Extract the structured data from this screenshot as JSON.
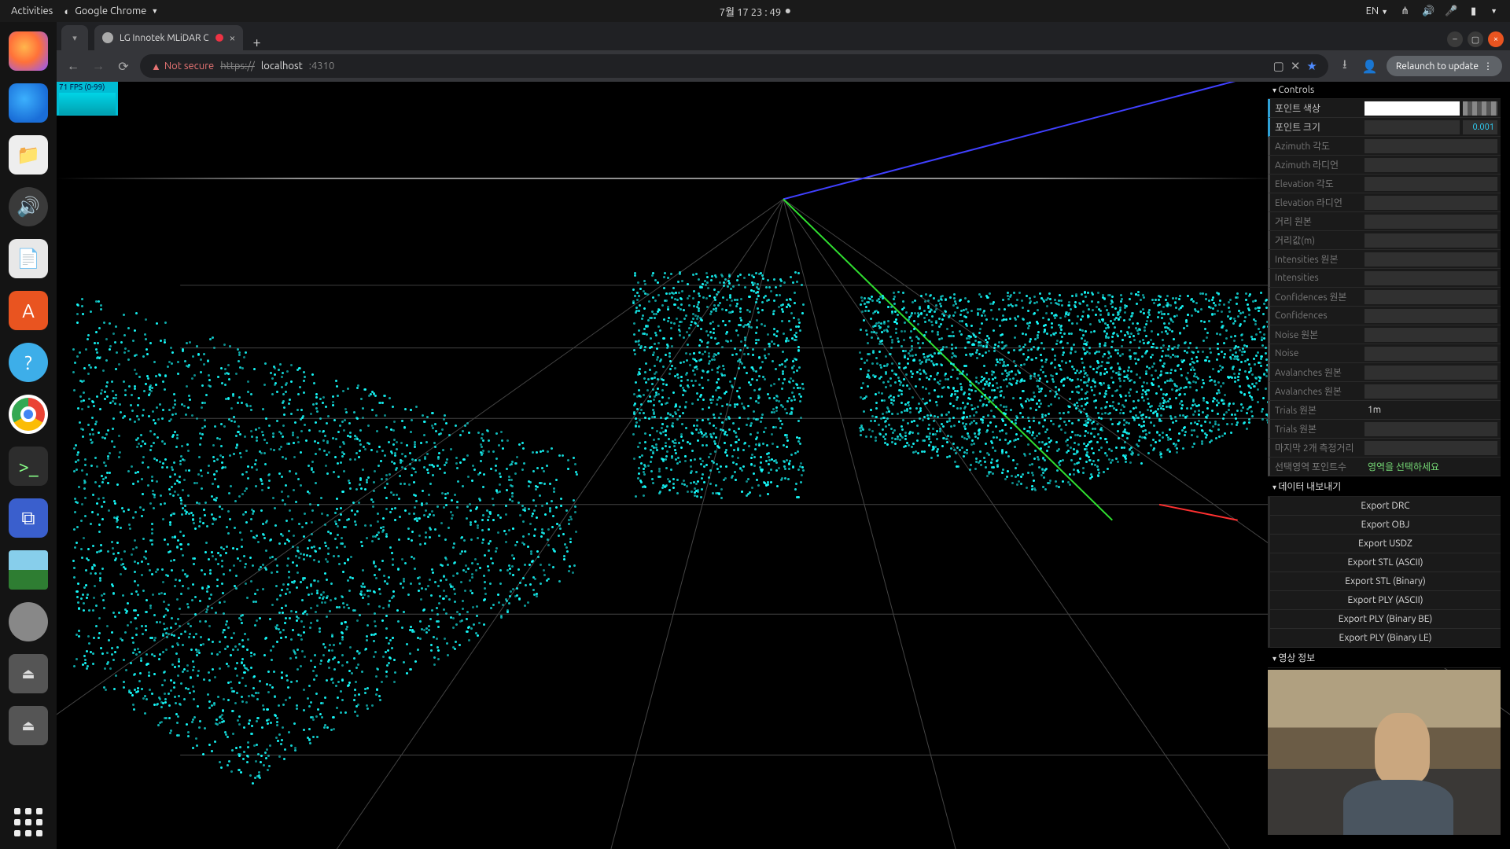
{
  "topbar": {
    "activities": "Activities",
    "app_menu": "Google Chrome",
    "clock": "7월 17  23 : 49",
    "lang": "EN"
  },
  "browser": {
    "tab_title": "LG Innotek MLiDAR C",
    "not_secure": "Not secure",
    "url_scheme": "https://",
    "url_host": "localhost",
    "url_port": ":4310",
    "relaunch": "Relaunch to update"
  },
  "fps": {
    "label": "71 FPS (0-99)"
  },
  "gui": {
    "sections": {
      "controls": "Controls",
      "export": "데이터 내보내기",
      "video": "영상 정보"
    },
    "point_color_label": "포인트 색상",
    "point_size": {
      "label": "포인트 크기",
      "value": "0.001"
    },
    "rows": [
      "Azimuth 각도",
      "Azimuth 라디언",
      "Elevation 각도",
      "Elevation 라디언",
      "거리 원본",
      "거리값(m)",
      "Intensities 원본",
      "Intensities",
      "Confidences 원본",
      "Confidences",
      "Noise 원본",
      "Noise",
      "Avalanches 원본",
      "Avalanches 원본",
      "Trials 원본",
      "Trials 원본"
    ],
    "trials_value": "1m",
    "last2_label": "마지막 2개 측정거리",
    "sel_count_label": "선택영역 포인트수",
    "sel_hint": "영역을 선택하세요",
    "exports": [
      "Export DRC",
      "Export OBJ",
      "Export USDZ",
      "Export STL (ASCII)",
      "Export STL (Binary)",
      "Export PLY (ASCII)",
      "Export PLY (Binary BE)",
      "Export PLY (Binary LE)"
    ]
  }
}
